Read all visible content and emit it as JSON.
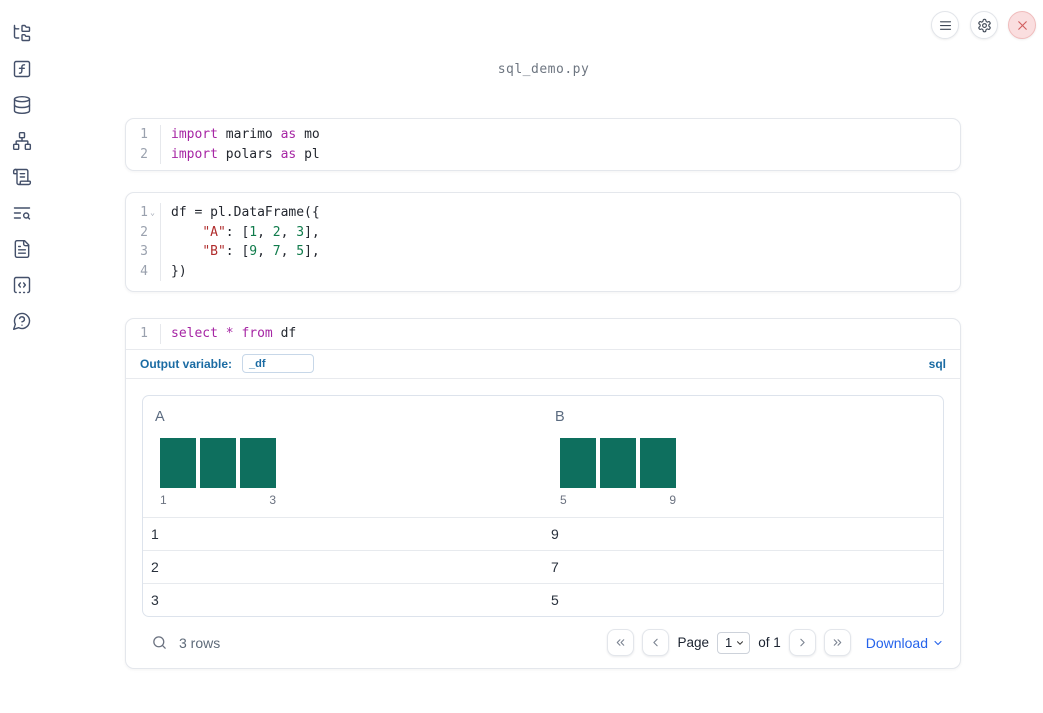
{
  "window": {
    "title": "sql_demo.py"
  },
  "toolbar": {
    "icons": [
      "menu-icon",
      "settings-gear-icon",
      "shutdown-close-icon"
    ]
  },
  "sidebar": {
    "icons": [
      "file-tree-icon",
      "function-square-icon",
      "database-icon",
      "network-graph-icon",
      "scroll-icon",
      "list-search-icon",
      "file-text-icon",
      "code-snippet-icon",
      "help-bubble-icon"
    ]
  },
  "cells": [
    {
      "type": "python",
      "lines": [
        {
          "num": "1",
          "tokens": [
            "import",
            " marimo ",
            "as",
            " mo"
          ]
        },
        {
          "num": "2",
          "tokens": [
            "import",
            " polars ",
            "as",
            " pl"
          ]
        }
      ]
    },
    {
      "type": "python",
      "lines": [
        {
          "num": "1",
          "fold": "⌄",
          "tokens": [
            "df = pl.DataFrame({"
          ]
        },
        {
          "num": "2",
          "tokens": [
            "    ",
            "\"A\"",
            ": [",
            "1",
            ", ",
            "2",
            ", ",
            "3",
            "],"
          ]
        },
        {
          "num": "3",
          "tokens": [
            "    ",
            "\"B\"",
            ": [",
            "9",
            ", ",
            "7",
            ", ",
            "5",
            "],"
          ]
        },
        {
          "num": "4",
          "tokens": [
            "})"
          ]
        }
      ]
    },
    {
      "type": "sql",
      "lines": [
        {
          "num": "1",
          "tokens": [
            "select",
            " ",
            "*",
            " ",
            "from",
            " df"
          ]
        }
      ],
      "output_variable_label": "Output variable:",
      "output_variable_value": "_df",
      "language_badge": "sql"
    }
  ],
  "table": {
    "columns": [
      {
        "header": "A",
        "hist_bars": 3,
        "hist_min_label": "1",
        "hist_max_label": "3"
      },
      {
        "header": "B",
        "hist_bars": 3,
        "hist_min_label": "5",
        "hist_max_label": "9"
      }
    ],
    "rows": [
      [
        "1",
        "9"
      ],
      [
        "2",
        "7"
      ],
      [
        "3",
        "5"
      ]
    ],
    "row_count": "3 rows",
    "pagination": {
      "page_label": "Page",
      "page_value": "1",
      "of_label": "of 1"
    },
    "download_label": "Download"
  },
  "colors": {
    "histogram_bar": "#0e6f5e",
    "sql_accent": "#1a6ba3",
    "download_link": "#2563eb",
    "close_button_bg": "#fadedf",
    "close_button_x": "#d05f5f",
    "syntax_keyword": "#a626a4",
    "syntax_string": "#b02c2c",
    "syntax_number": "#0f7b4b"
  }
}
